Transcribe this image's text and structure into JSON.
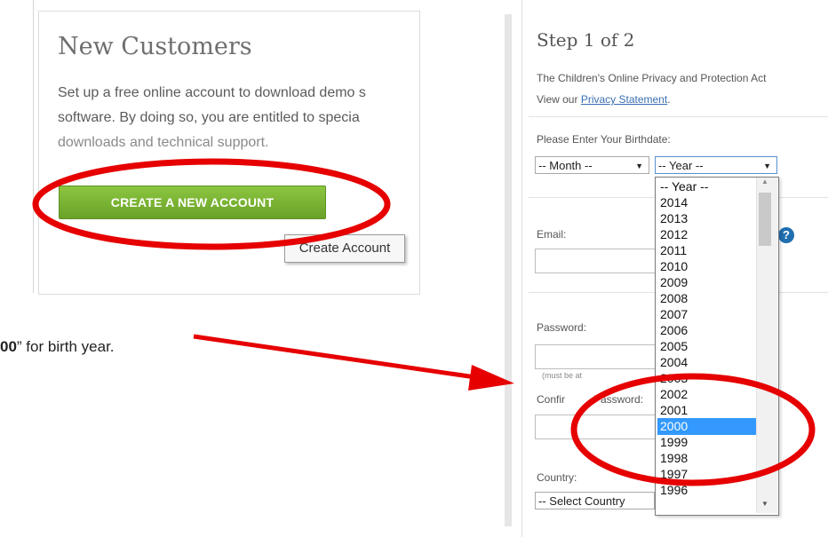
{
  "left": {
    "title": "New Customers",
    "body_lines": [
      "Set up a free online account to download demo s",
      "software. By doing so, you are entitled to specia",
      "downloads and technical support."
    ],
    "create_button": "CREATE A NEW ACCOUNT",
    "tooltip": "Create Account"
  },
  "caption": {
    "bold_part": "00",
    "rest": "” for birth year."
  },
  "right": {
    "step_title": "Step 1 of 2",
    "coppa_text": "The Children's Online Privacy and Protection Act",
    "view_prefix": "View our ",
    "privacy_link": "Privacy Statement",
    "privacy_suffix": ".",
    "birthdate_label": "Please Enter Your Birthdate:",
    "month_select": "-- Month --",
    "year_select": "-- Year --",
    "email_label": "Email:",
    "password_label": "Password:",
    "password_hint": "(must be at",
    "confirm_label_a": "Confir",
    "confirm_label_b": "Password:",
    "country_label": "Country:",
    "country_select": "-- Select Country",
    "year_options": [
      "-- Year --",
      "2014",
      "2013",
      "2012",
      "2011",
      "2010",
      "2009",
      "2008",
      "2007",
      "2006",
      "2005",
      "2004",
      "2003",
      "2002",
      "2001",
      "2000",
      "1999",
      "1998",
      "1997",
      "1996"
    ],
    "selected_year": "2000",
    "help_glyph": "?"
  },
  "colors": {
    "annotation_red": "#e60000",
    "button_green": "#7bb43a",
    "selection_blue": "#3399ff"
  }
}
